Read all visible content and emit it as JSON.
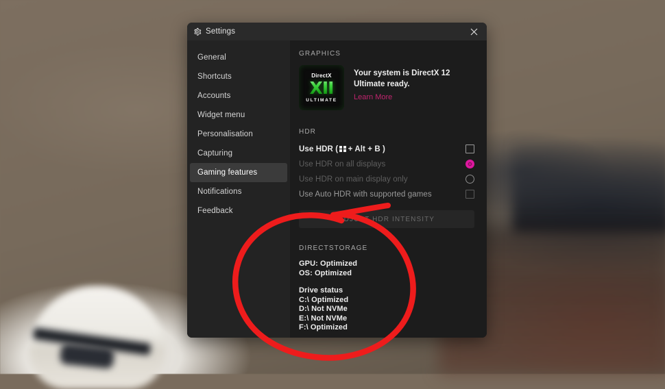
{
  "window": {
    "title": "Settings",
    "gear_icon": "gear-icon",
    "close_icon": "close-icon"
  },
  "sidebar": {
    "items": [
      {
        "label": "General",
        "selected": false
      },
      {
        "label": "Shortcuts",
        "selected": false
      },
      {
        "label": "Accounts",
        "selected": false
      },
      {
        "label": "Widget menu",
        "selected": false
      },
      {
        "label": "Personalisation",
        "selected": false
      },
      {
        "label": "Capturing",
        "selected": false
      },
      {
        "label": "Gaming features",
        "selected": true
      },
      {
        "label": "Notifications",
        "selected": false
      },
      {
        "label": "Feedback",
        "selected": false
      }
    ]
  },
  "graphics": {
    "heading": "GRAPHICS",
    "badge": {
      "top": "DirectX",
      "main": "XII",
      "bottom": "ULTIMATE"
    },
    "message": "Your system is DirectX 12 Ultimate ready.",
    "learn_more": "Learn More"
  },
  "hdr": {
    "heading": "HDR",
    "use_hdr_prefix": "Use HDR (",
    "use_hdr_suffix": "+ Alt + B )",
    "use_hdr_checked": false,
    "options": [
      {
        "label": "Use HDR on all displays",
        "control": "radio",
        "checked": true
      },
      {
        "label": "Use HDR on main display only",
        "control": "radio",
        "checked": false
      },
      {
        "label": "Use Auto HDR with supported games",
        "control": "checkbox",
        "checked": false
      }
    ],
    "adjust_button": "ADJUST HDR INTENSITY"
  },
  "directstorage": {
    "heading": "DIRECTSTORAGE",
    "gpu": "GPU: Optimized",
    "os": "OS: Optimized",
    "drive_status_label": "Drive status",
    "drives": [
      "C:\\ Optimized",
      "D:\\ Not NVMe",
      "E:\\ Not NVMe",
      "F:\\ Optimized"
    ]
  },
  "annotation": {
    "shape": "hand-drawn-red-ellipse",
    "color": "#ee1c1c"
  },
  "colors": {
    "window_bg": "#1c1c1c",
    "sidebar_bg": "#232323",
    "titlebar_bg": "#2a2a2a",
    "selected_item_bg": "#3b3b3b",
    "accent_pink": "#e018a0",
    "link_pink": "#c0246e",
    "annotation_red": "#ee1c1c",
    "desktop_bg": "#7a6c5d"
  }
}
